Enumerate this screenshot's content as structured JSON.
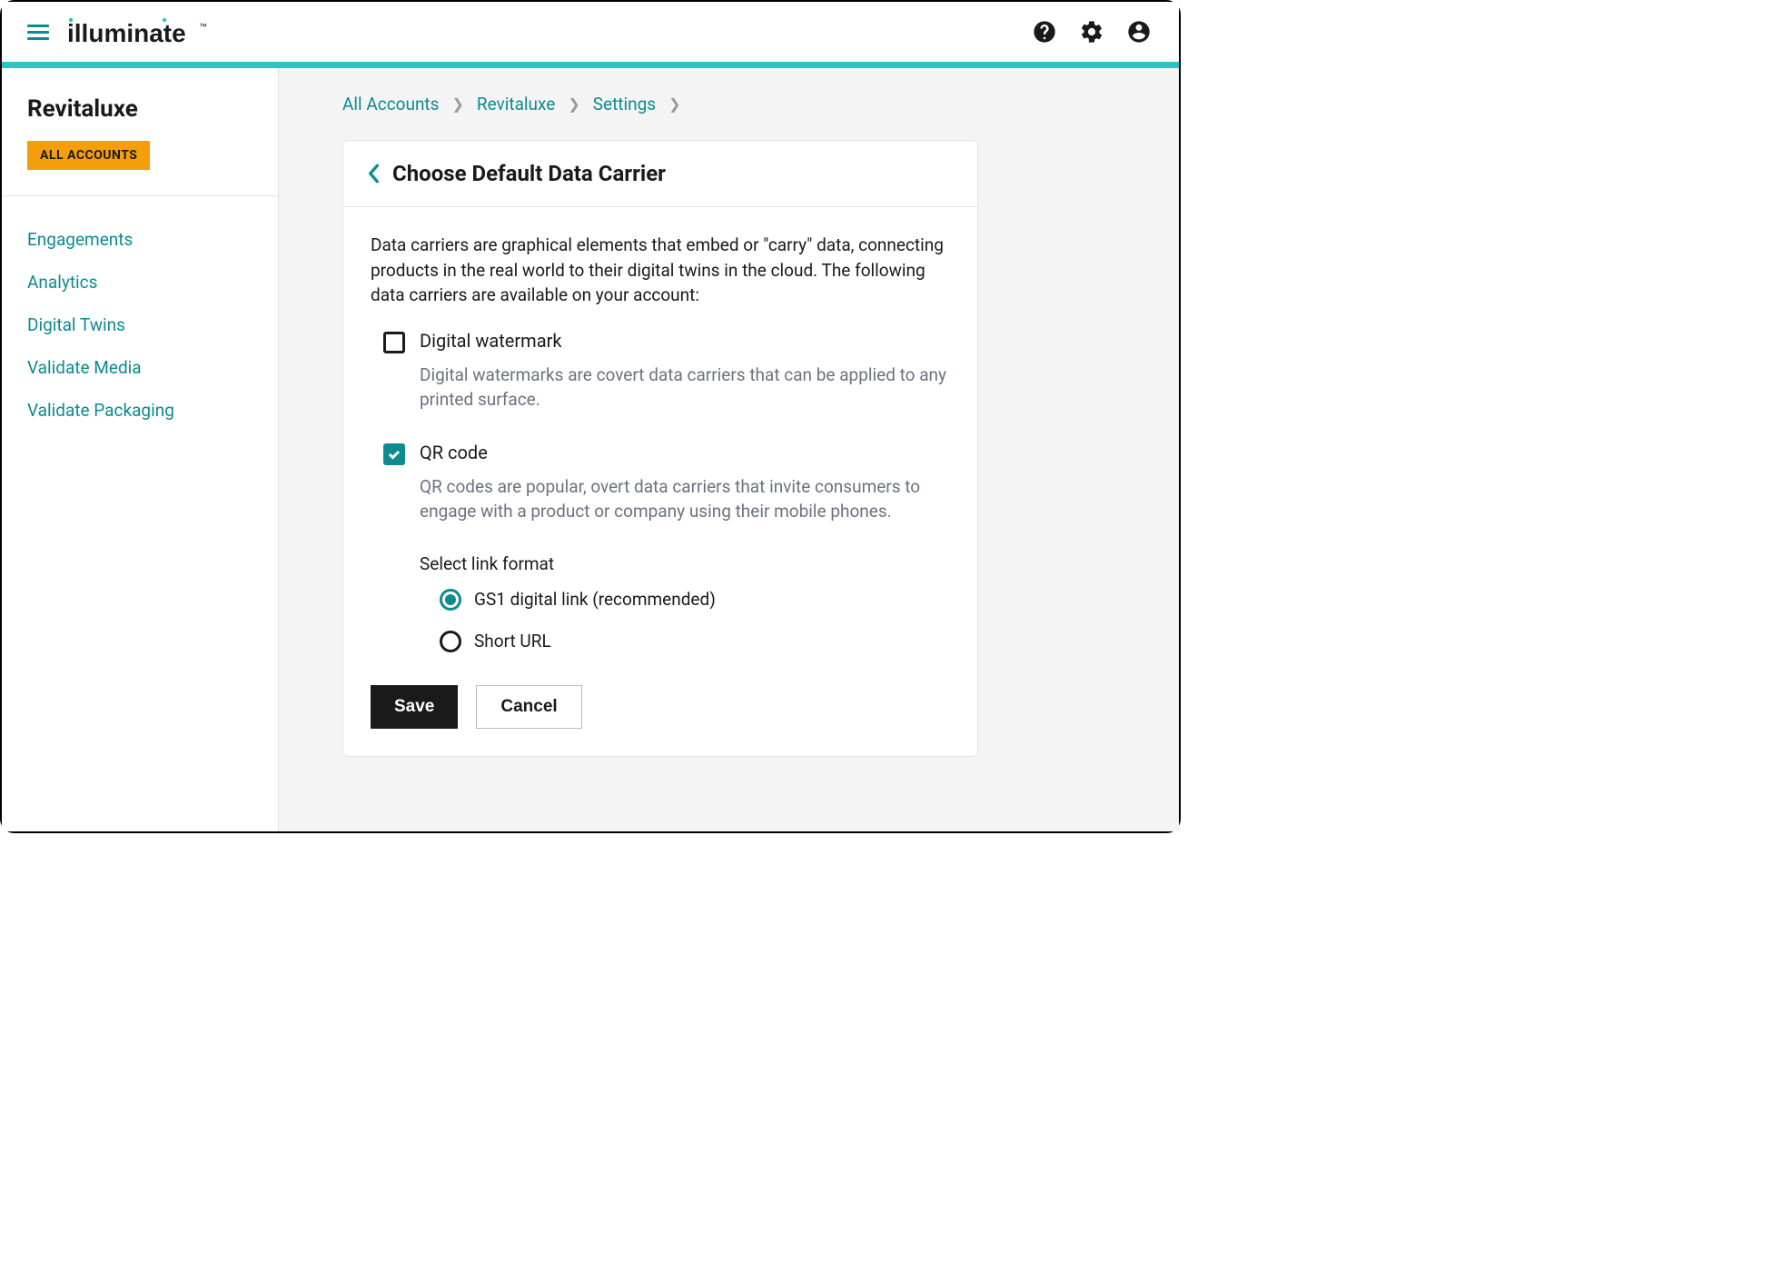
{
  "brand": "illuminate",
  "account": "Revitaluxe",
  "allAccountsLabel": "ALL ACCOUNTS",
  "sidebar": {
    "items": [
      {
        "label": "Engagements"
      },
      {
        "label": "Analytics"
      },
      {
        "label": "Digital Twins"
      },
      {
        "label": "Validate Media"
      },
      {
        "label": "Validate Packaging"
      }
    ]
  },
  "breadcrumb": {
    "items": [
      {
        "label": "All Accounts"
      },
      {
        "label": "Revitaluxe"
      },
      {
        "label": "Settings"
      }
    ]
  },
  "panel": {
    "title": "Choose Default Data Carrier",
    "description": "Data carriers are graphical elements that embed or \"carry\" data, connecting products in the real world to their digital twins in the cloud. The following data carriers are available on your account:",
    "options": {
      "watermark": {
        "label": "Digital watermark",
        "checked": false,
        "description": "Digital watermarks are covert data carriers that can be applied to any printed surface."
      },
      "qr": {
        "label": "QR code",
        "checked": true,
        "description": "QR codes are popular, overt data carriers that invite consumers to engage with a product or company using their mobile phones.",
        "linkFormatTitle": "Select link format",
        "linkFormats": [
          {
            "label": "GS1 digital link (recommended)",
            "selected": true
          },
          {
            "label": "Short URL",
            "selected": false
          }
        ]
      }
    },
    "saveLabel": "Save",
    "cancelLabel": "Cancel"
  }
}
